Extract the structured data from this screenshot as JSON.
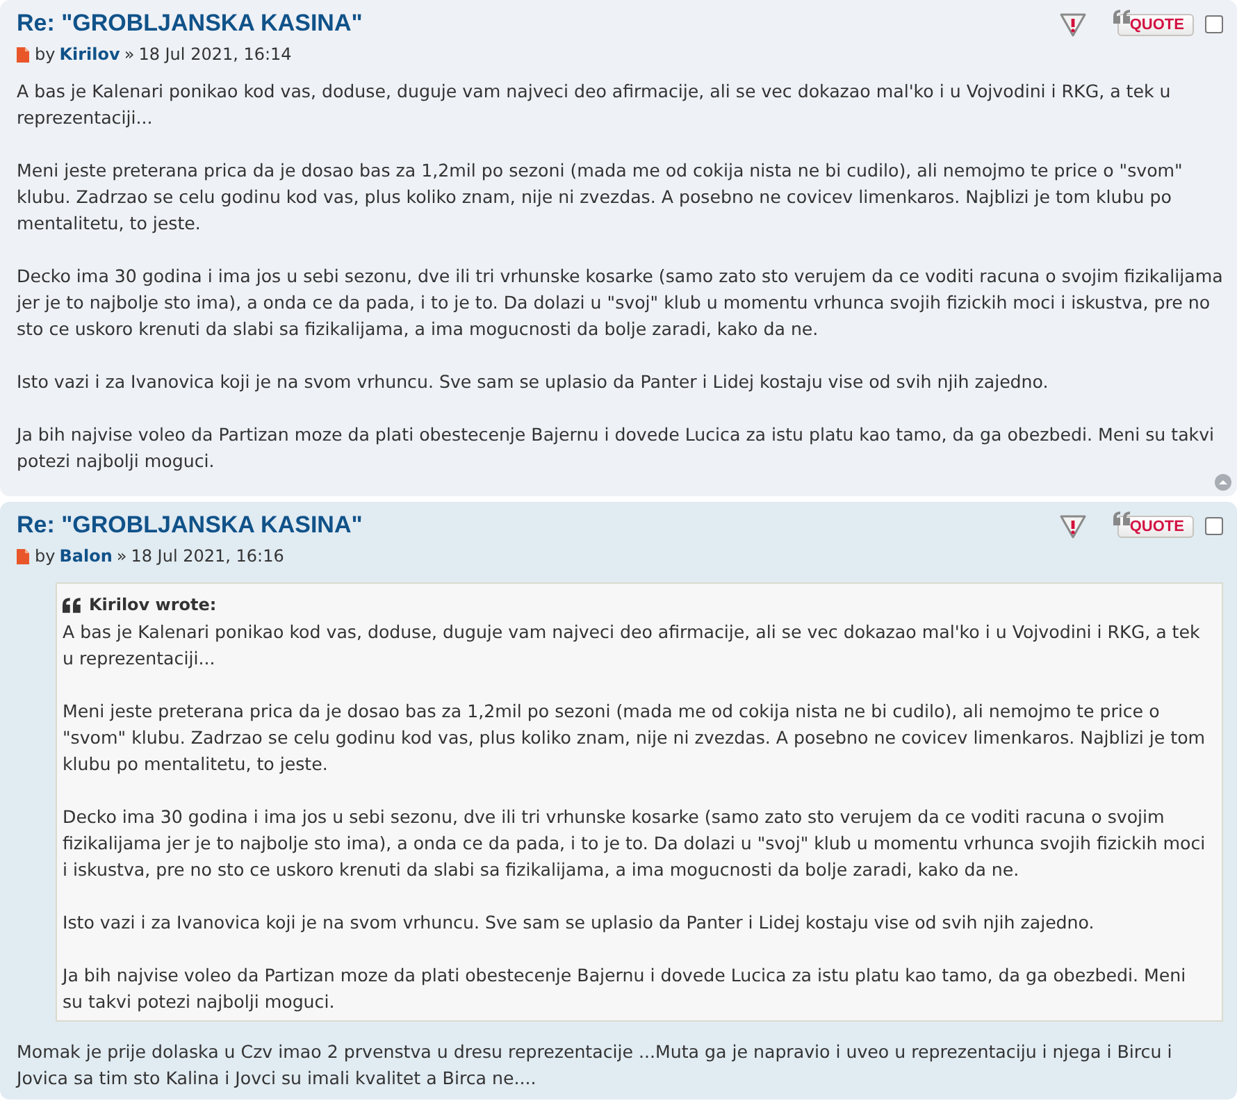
{
  "posts": [
    {
      "title": "Re: \"GROBLJANSKA KASINA\"",
      "by": "by",
      "author": "Kirilov",
      "separator": "»",
      "date": "18 Jul 2021, 16:14",
      "quote_button": "QUOTE",
      "selected": false,
      "back_to_top": true,
      "paragraphs": [
        "A bas je Kalenari ponikao kod vas, doduse, duguje vam najveci deo afirmacije, ali se vec dokazao mal'ko i u Vojvodini i RKG, a tek u reprezentaciji...",
        "Meni jeste preterana prica da je dosao bas za 1,2mil po sezoni (mada me od cokija nista ne bi cudilo), ali nemojmo te price o \"svom\" klubu. Zadrzao se celu godinu kod vas, plus koliko znam, nije ni zvezdas. A posebno ne covicev limenkaros. Najblizi je tom klubu po mentalitetu, to jeste.",
        "Decko ima 30 godina i ima jos u sebi sezonu, dve ili tri vrhunske kosarke (samo zato sto verujem da ce voditi racuna o svojim fizikalijama jer je to najbolje sto ima), a onda ce da pada, i to je to. Da dolazi u \"svoj\" klub u momentu vrhunca svojih fizickih moci i iskustva, pre no sto ce uskoro krenuti da slabi sa fizikalijama, a ima mogucnosti da bolje zaradi, kako da ne.",
        "Isto vazi i za Ivanovica koji je na svom vrhuncu. Sve sam se uplasio da Panter i Lidej kostaju vise od svih njih zajedno.",
        "Ja bih najvise voleo da Partizan moze da plati obestecenje Bajernu i dovede Lucica za istu platu kao tamo, da ga obezbedi. Meni su takvi potezi najbolji moguci."
      ]
    },
    {
      "title": "Re: \"GROBLJANSKA KASINA\"",
      "by": "by",
      "author": "Balon",
      "separator": "»",
      "date": "18 Jul 2021, 16:16",
      "quote_button": "QUOTE",
      "selected": false,
      "back_to_top": false,
      "quote": {
        "cite": "Kirilov wrote:",
        "paragraphs": [
          "A bas je Kalenari ponikao kod vas, doduse, duguje vam najveci deo afirmacije, ali se vec dokazao mal'ko i u Vojvodini i RKG, a tek u reprezentaciji...",
          "Meni jeste preterana prica da je dosao bas za 1,2mil po sezoni (mada me od cokija nista ne bi cudilo), ali nemojmo te price o \"svom\" klubu. Zadrzao se celu godinu kod vas, plus koliko znam, nije ni zvezdas. A posebno ne covicev limenkaros. Najblizi je tom klubu po mentalitetu, to jeste.",
          "Decko ima 30 godina i ima jos u sebi sezonu, dve ili tri vrhunske kosarke (samo zato sto verujem da ce voditi racuna o svojim fizikalijama jer je to najbolje sto ima), a onda ce da pada, i to je to. Da dolazi u \"svoj\" klub u momentu vrhunca svojih fizickih moci i iskustva, pre no sto ce uskoro krenuti da slabi sa fizikalijama, a ima mogucnosti da bolje zaradi, kako da ne.",
          "Isto vazi i za Ivanovica koji je na svom vrhuncu. Sve sam se uplasio da Panter i Lidej kostaju vise od svih njih zajedno.",
          "Ja bih najvise voleo da Partizan moze da plati obestecenje Bajernu i dovede Lucica za istu platu kao tamo, da ga obezbedi. Meni su takvi potezi najbolji moguci."
        ]
      },
      "paragraphs": [
        "Momak je prije dolaska u Czv imao 2 prvenstva u dresu reprezentacije ...Muta ga je napravio i uveo u reprezentaciju i njega i Bircu i Jovica sa tim sto Kalina i Jovci su imali kvalitet a Birca ne...."
      ]
    }
  ]
}
